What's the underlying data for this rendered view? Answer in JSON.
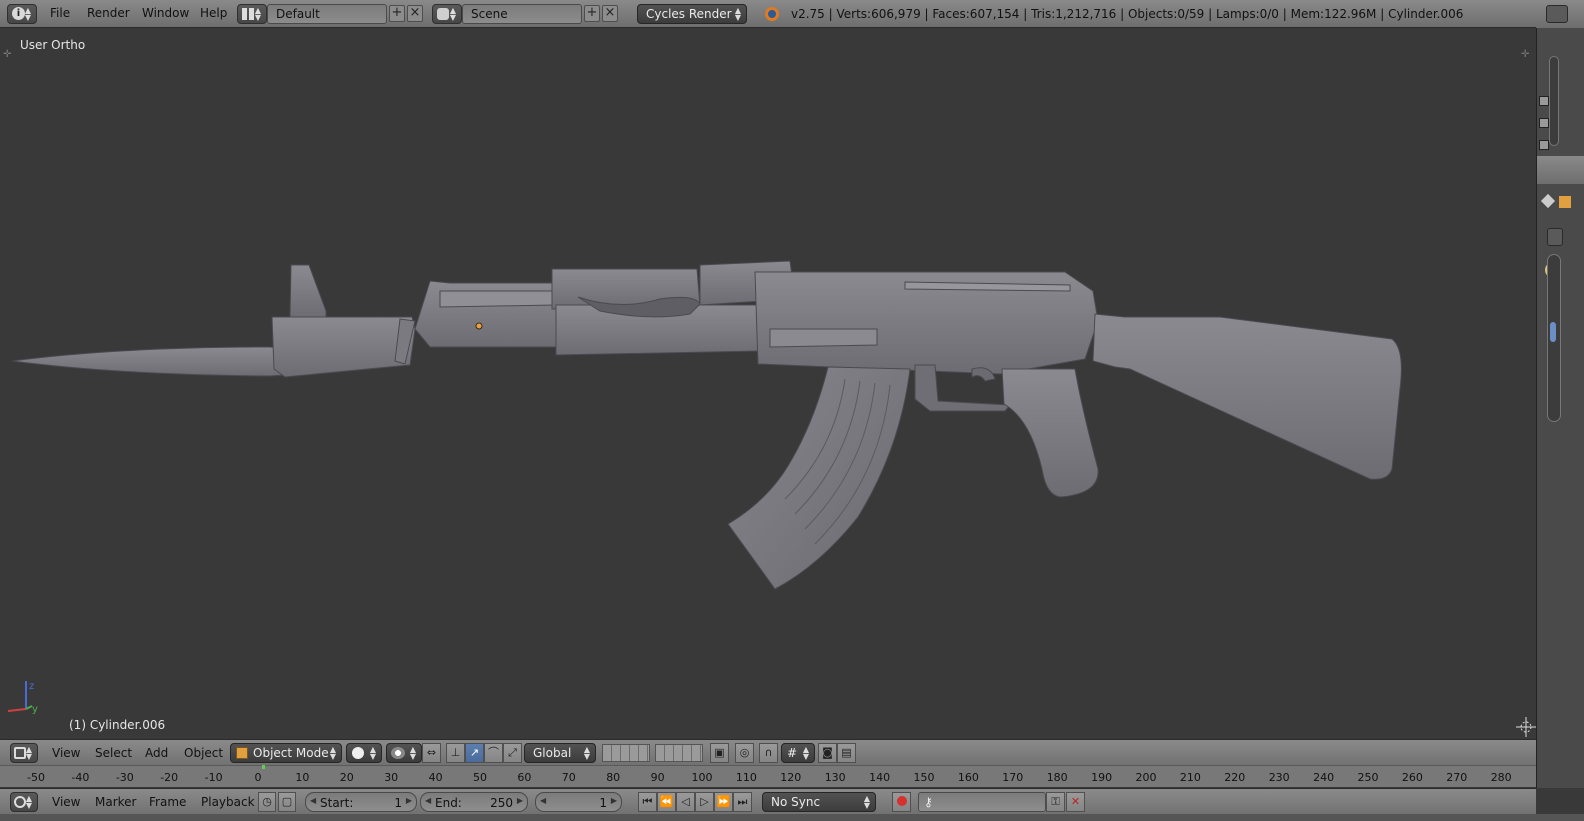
{
  "topbar": {
    "menus": [
      "File",
      "Render",
      "Window",
      "Help"
    ],
    "screen_layout": "Default",
    "scene": "Scene",
    "render_engine": "Cycles Render",
    "stats": "v2.75 | Verts:606,979 | Faces:607,154 | Tris:1,212,716 | Objects:0/59 | Lamps:0/0 | Mem:122.96M | Cylinder.006"
  },
  "viewport": {
    "view_label": "User Ortho",
    "object_label": "(1) Cylinder.006",
    "axis_z": "z",
    "axis_y": "y",
    "background_color": "#393939",
    "model_color": "#7b7b80"
  },
  "view_header": {
    "menus": [
      "View",
      "Select",
      "Add",
      "Object"
    ],
    "mode": "Object Mode",
    "orientation": "Global"
  },
  "timeline": {
    "ticks": [
      "-50",
      "-40",
      "-30",
      "-20",
      "-10",
      "0",
      "10",
      "20",
      "30",
      "40",
      "50",
      "60",
      "70",
      "80",
      "90",
      "100",
      "110",
      "120",
      "130",
      "140",
      "150",
      "160",
      "170",
      "180",
      "190",
      "200",
      "210",
      "220",
      "230",
      "240",
      "250",
      "260",
      "270",
      "280"
    ],
    "menus": [
      "View",
      "Marker",
      "Frame",
      "Playback"
    ],
    "start_label": "Start:",
    "start_value": "1",
    "end_label": "End:",
    "end_value": "250",
    "current_frame": "1",
    "sync": "No Sync"
  },
  "icons": {
    "info": "info-icon",
    "layout": "screen-layout-icon",
    "scene": "scene-icon",
    "blender": "blender-logo-icon",
    "cube": "cube-icon",
    "record": "record-icon"
  }
}
